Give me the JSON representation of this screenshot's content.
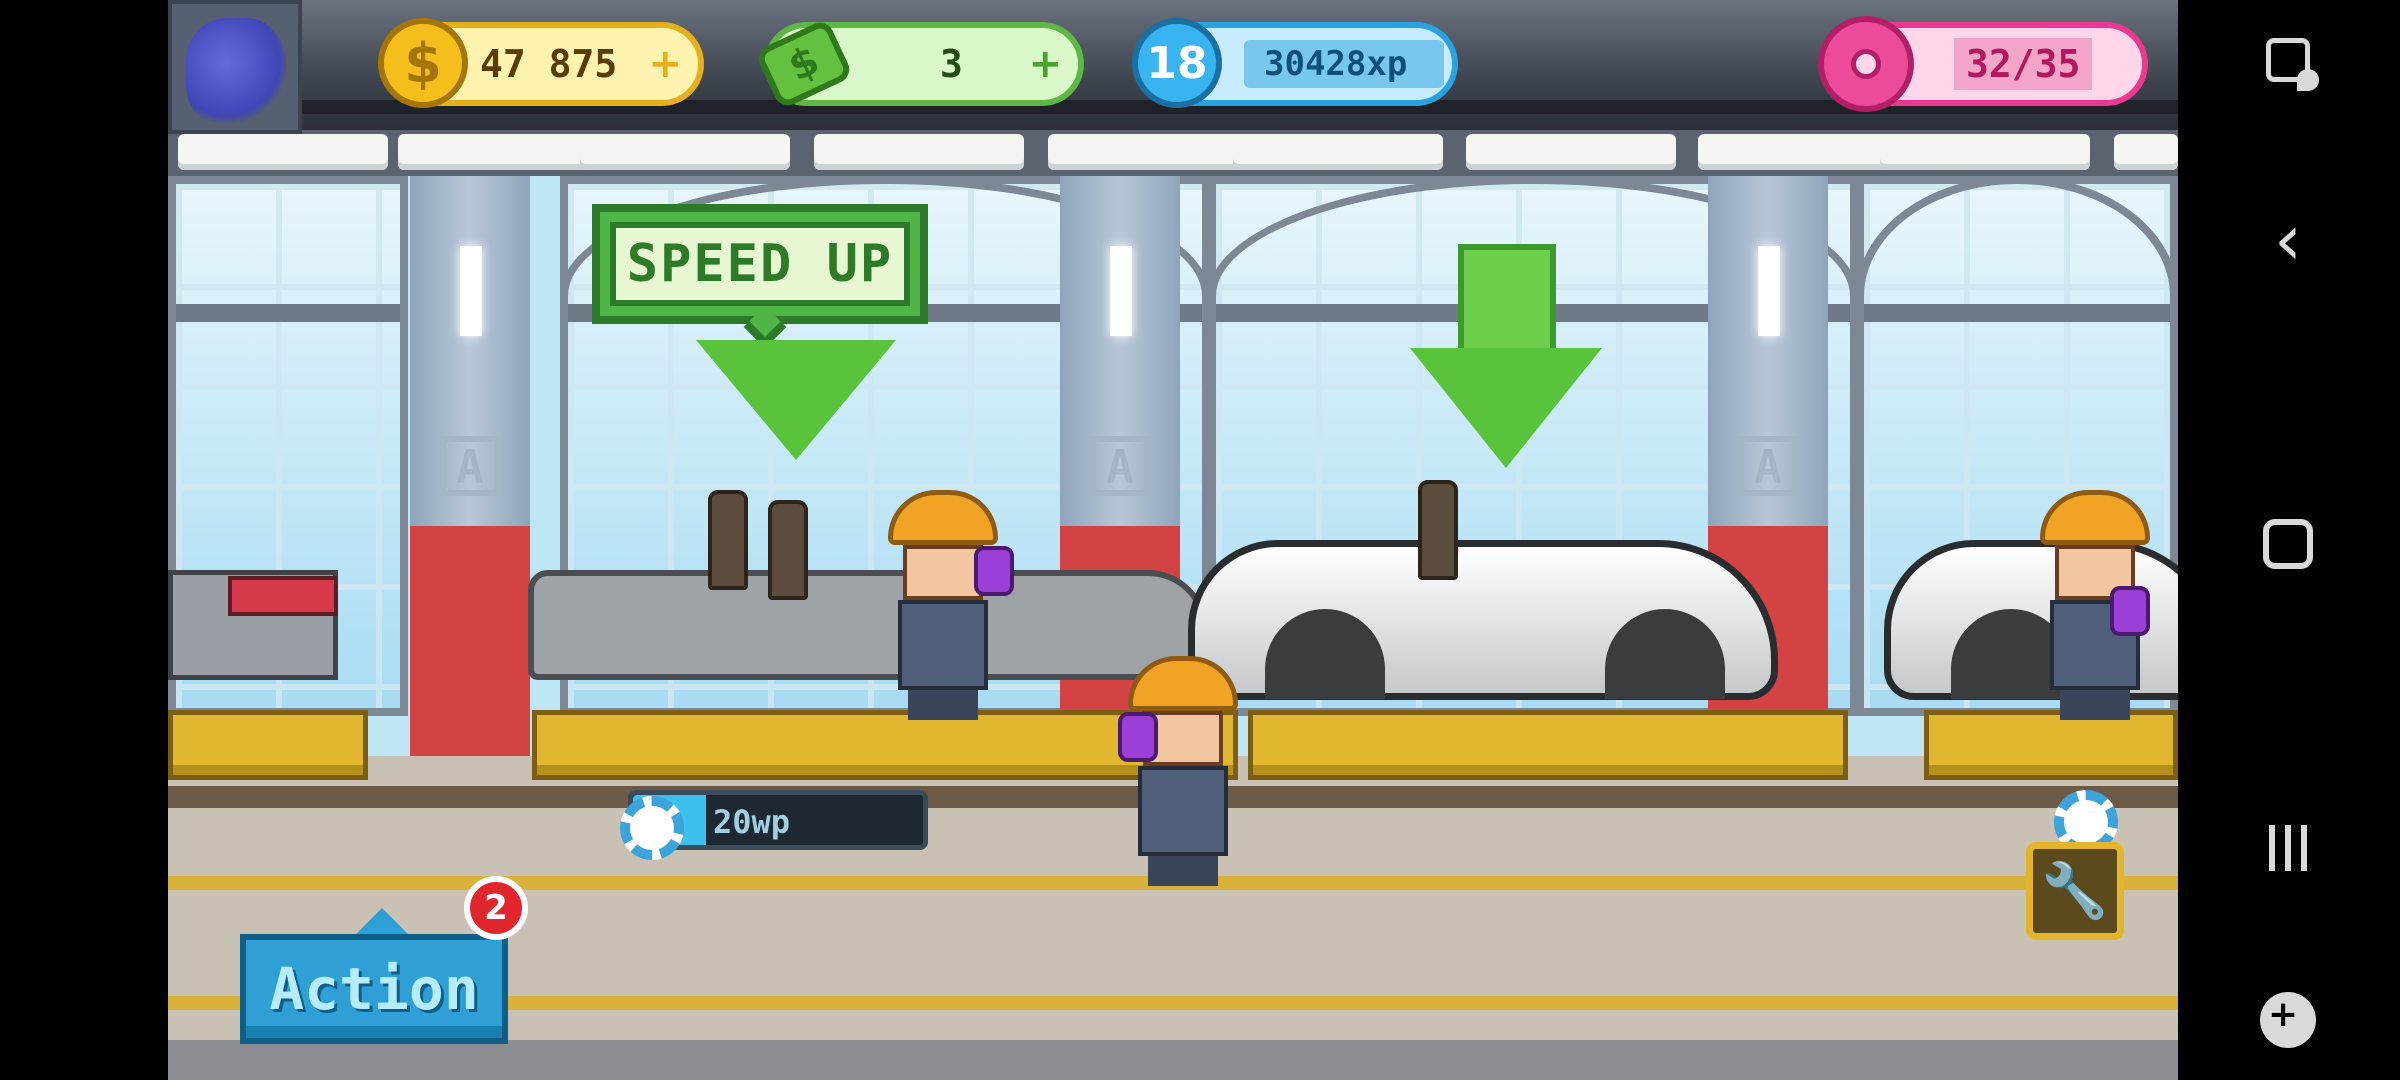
{
  "hud": {
    "coins": "47 875",
    "coins_plus": "+",
    "cash": "3",
    "cash_plus": "+",
    "level": "18",
    "xp": "30428xp",
    "donuts": "32/35",
    "coin_symbol": "$"
  },
  "sign": {
    "speed_up": "SPEED UP"
  },
  "work": {
    "progress_text": "20wp",
    "progress_fraction": 0.25
  },
  "action": {
    "label": "Action",
    "badge": "2"
  },
  "icons": {
    "coin": "coin-icon",
    "cash": "cash-icon",
    "level": "level-badge-icon",
    "donut": "donut-icon",
    "gear": "gear-icon",
    "wrench": "wrench-icon"
  },
  "colors": {
    "accent_blue": "#2ea0d6",
    "sign_green": "#4fb547",
    "coin_gold": "#f5bf1b",
    "donut_pink": "#ec4a9a",
    "badge_red": "#e2262e"
  }
}
